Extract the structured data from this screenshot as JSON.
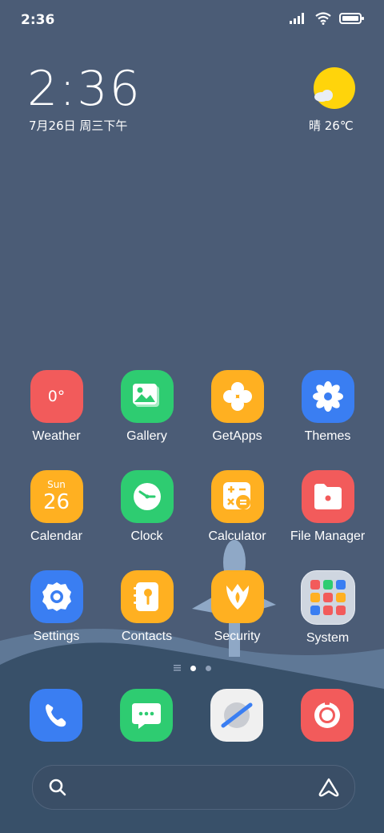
{
  "status_bar": {
    "time": "2:36"
  },
  "clock_widget": {
    "time": "2:36",
    "date": "7月26日 周三下午"
  },
  "weather_widget": {
    "summary": "晴 26℃"
  },
  "apps": {
    "weather": {
      "label": "Weather",
      "icon_text": "0°",
      "color": "#f25b5b"
    },
    "gallery": {
      "label": "Gallery",
      "color": "#2ecc71"
    },
    "getapps": {
      "label": "GetApps",
      "color": "#ffb021"
    },
    "themes": {
      "label": "Themes",
      "color": "#3a7ef2"
    },
    "calendar": {
      "label": "Calendar",
      "day_name": "Sun",
      "day_number": "26",
      "color": "#ffb021"
    },
    "clock": {
      "label": "Clock",
      "color": "#2ecc71"
    },
    "calculator": {
      "label": "Calculator",
      "color": "#ffb021"
    },
    "file_manager": {
      "label": "File Manager",
      "color": "#f25b5b"
    },
    "settings": {
      "label": "Settings",
      "color": "#3a7ef2"
    },
    "contacts": {
      "label": "Contacts",
      "color": "#ffb021"
    },
    "security": {
      "label": "Security",
      "color": "#ffb021"
    },
    "system": {
      "label": "System",
      "color": "#cfd6e0"
    }
  },
  "dock": {
    "phone": {
      "icon": "phone-icon",
      "color": "#3a7ef2"
    },
    "messages": {
      "icon": "message-icon",
      "color": "#2ecc71"
    },
    "browser": {
      "icon": "browser-icon",
      "color": "#f0f0f0"
    },
    "camera": {
      "icon": "camera-icon",
      "color": "#f25b5b"
    }
  },
  "page_indicator": {
    "current": 1,
    "total": 2
  },
  "search_bar": {
    "icon": "search-icon",
    "assistant_icon": "assistant-icon"
  }
}
